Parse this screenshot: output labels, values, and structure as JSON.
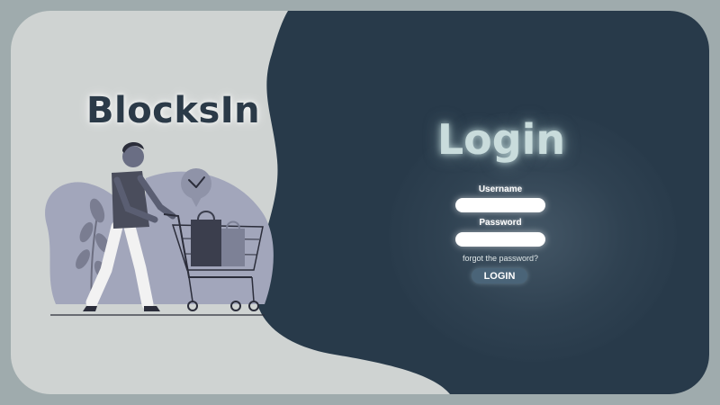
{
  "brand": {
    "name": "BlocksIn"
  },
  "login": {
    "title": "Login",
    "username_label": "Username",
    "username_value": "",
    "password_label": "Password",
    "password_value": "",
    "forgot_link": "forgot the password?",
    "submit_label": "LOGIN"
  },
  "colors": {
    "page_background": "#9fabad",
    "light_panel": "#cfd3d2",
    "dark_panel": "#283a4a",
    "brand_text": "#2b3a48",
    "login_title": "#c9dcdc",
    "button_bg": "#4a6478"
  },
  "illustration": {
    "subject": "person-pushing-shopping-cart-icon"
  }
}
